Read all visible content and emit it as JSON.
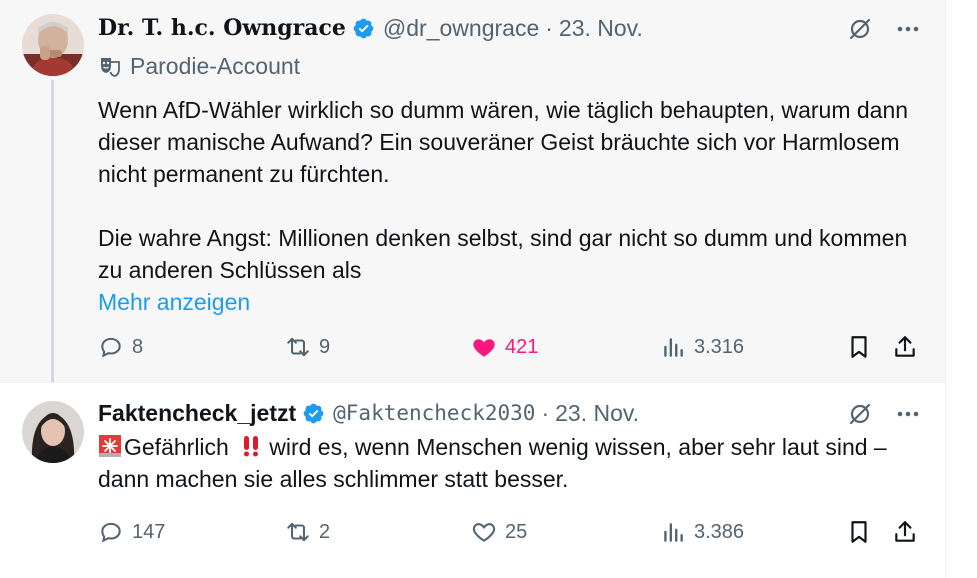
{
  "tweets": [
    {
      "display_name": "Dr. T. h.c. Owngrace",
      "handle": "@dr_owngrace",
      "separator": "·",
      "date": "23. Nov.",
      "badge": "Parodie-Account",
      "text_paragraphs": [
        "Wenn AfD-Wähler wirklich so dumm wären, wie täglich behaupten, warum dann dieser manische Aufwand? Ein souveräner Geist bräuchte sich vor Harmlosem nicht permanent zu fürchten.",
        "Die wahre Angst: Millionen denken selbst, sind gar nicht so dumm und kommen zu anderen Schlüssen als"
      ],
      "show_more": "Mehr anzeigen",
      "replies": "8",
      "retweets": "9",
      "likes": "421",
      "views": "3.316",
      "liked": true
    },
    {
      "display_name": "Faktencheck_jetzt",
      "handle": "@Faktencheck2030",
      "separator": "·",
      "date": "23. Nov.",
      "text_line1": "Gefährlich",
      "text_after_emoji": "wird es, wenn Menschen wenig wissen, aber sehr laut sind – dann machen sie alles schlimmer statt besser.",
      "replies": "147",
      "retweets": "2",
      "likes": "25",
      "views": "3.386",
      "liked": false
    }
  ],
  "icons": {
    "verified": "verified-badge-icon",
    "grok": "grok-icon",
    "more": "more-dots-icon",
    "parody": "parody-mask-icon",
    "siren": "siren-emoji-icon",
    "double_exclamation": "double-exclamation-emoji-icon",
    "reply": "reply-icon",
    "retweet": "retweet-icon",
    "like": "heart-icon",
    "views": "views-icon",
    "bookmark": "bookmark-icon",
    "share": "share-icon"
  },
  "colors": {
    "link_blue": "#1d9bf0",
    "like_pink": "#f91880",
    "muted_gray": "#536471",
    "text": "#0f1419",
    "highlight_bg": "#f7f7f7"
  }
}
